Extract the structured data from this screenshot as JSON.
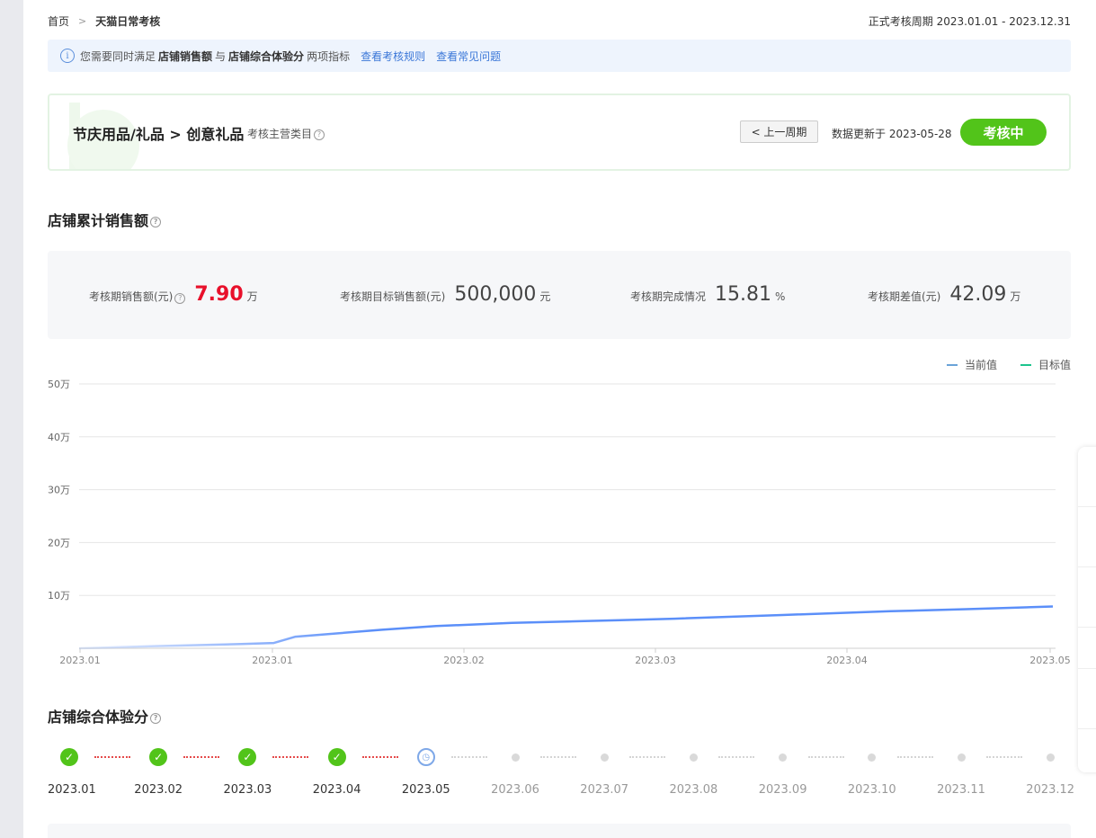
{
  "breadcrumb": {
    "home": "首页",
    "sep": ">",
    "current": "天猫日常考核"
  },
  "period": {
    "label": "正式考核周期",
    "range": "2023.01.01 - 2023.12.31"
  },
  "notice": {
    "icon": "info-icon",
    "prefix": "您需要同时满足",
    "metric1": "店铺销售额",
    "conj": "与",
    "metric2": "店铺综合体验分",
    "suffix": "两项指标",
    "link1": "查看考核规则",
    "link2": "查看常见问题"
  },
  "category": {
    "title": "节庆用品/礼品 > 创意礼品",
    "subtitle": "考核主营类目",
    "prev_button": "< 上一周期",
    "updated": "数据更新于 2023-05-28",
    "status": "考核中"
  },
  "sales": {
    "title": "店铺累计销售额",
    "stats": [
      {
        "label": "考核期销售额(元)",
        "value": "7.90",
        "unit": "万"
      },
      {
        "label": "考核期目标销售额(元)",
        "value": "500,000",
        "unit": "元"
      },
      {
        "label": "考核期完成情况",
        "value": "15.81",
        "unit": "%"
      },
      {
        "label": "考核期差值(元)",
        "value": "42.09",
        "unit": "万"
      }
    ]
  },
  "chart_data": {
    "type": "line",
    "x": [
      "2023.01",
      "2023.01",
      "2023.02",
      "2023.03",
      "2023.04",
      "2023.05"
    ],
    "yticks": [
      "10万",
      "20万",
      "30万",
      "40万",
      "50万"
    ],
    "ylim": [
      0,
      50
    ],
    "series": [
      {
        "name": "当前值",
        "color": "#5b8ff9",
        "points": [
          [
            0,
            0
          ],
          [
            0.7,
            0.4
          ],
          [
            1.5,
            0.8
          ],
          [
            1.8,
            1.0
          ],
          [
            2.0,
            2.2
          ],
          [
            2.8,
            3.5
          ],
          [
            3.3,
            4.2
          ],
          [
            4.0,
            4.8
          ],
          [
            5.0,
            5.3
          ],
          [
            5.5,
            5.6
          ],
          [
            6.5,
            6.3
          ],
          [
            7.5,
            7.0
          ],
          [
            8.2,
            7.4
          ],
          [
            9.0,
            7.9
          ]
        ]
      },
      {
        "name": "目标值",
        "color": "#1cc48d",
        "value": 50
      }
    ],
    "grid": true,
    "legend": "top-right"
  },
  "experience": {
    "title": "店铺综合体验分",
    "months": [
      {
        "label": "2023.01",
        "state": "done"
      },
      {
        "label": "2023.02",
        "state": "done"
      },
      {
        "label": "2023.03",
        "state": "done"
      },
      {
        "label": "2023.04",
        "state": "done"
      },
      {
        "label": "2023.05",
        "state": "current"
      },
      {
        "label": "2023.06",
        "state": "future"
      },
      {
        "label": "2023.07",
        "state": "future"
      },
      {
        "label": "2023.08",
        "state": "future"
      },
      {
        "label": "2023.09",
        "state": "future"
      },
      {
        "label": "2023.10",
        "state": "future"
      },
      {
        "label": "2023.11",
        "state": "future"
      },
      {
        "label": "2023.12",
        "state": "future"
      }
    ]
  },
  "side_panel": {
    "rows": [
      "",
      "",
      "",
      "",
      "",
      ""
    ]
  }
}
